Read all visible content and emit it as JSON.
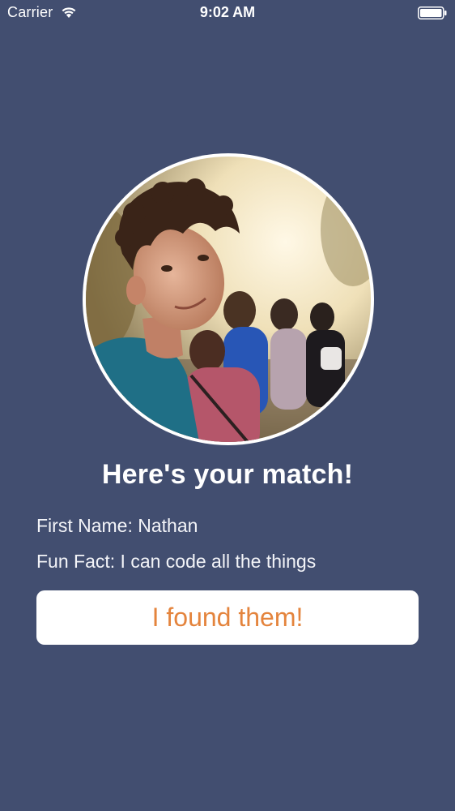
{
  "status_bar": {
    "carrier": "Carrier",
    "time": "9:02 AM",
    "wifi_icon": "wifi-icon",
    "battery_icon": "battery-icon"
  },
  "match": {
    "avatar_icon": "avatar-photo",
    "headline": "Here's your match!",
    "first_name_line": "First Name: Nathan",
    "fun_fact_line": "Fun Fact: I can code all the things",
    "found_button_label": "I found them!"
  },
  "colors": {
    "background": "#424e70",
    "button_background": "#ffffff",
    "button_text": "#e4843d",
    "text": "#ffffff"
  }
}
